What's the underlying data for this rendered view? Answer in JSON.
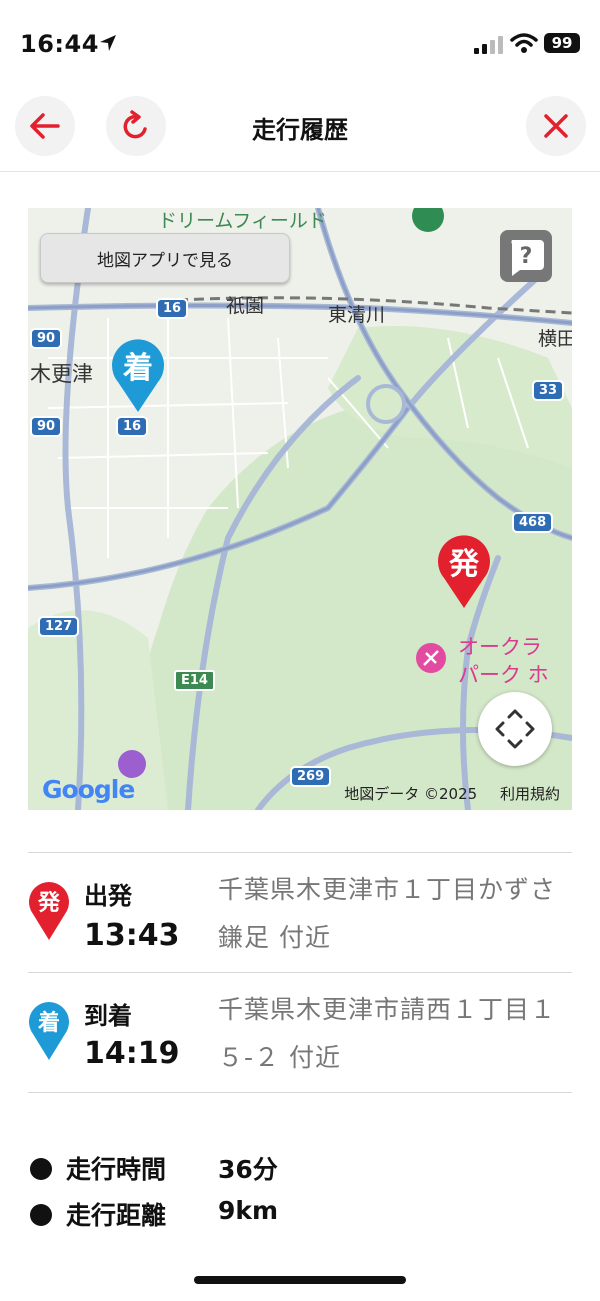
{
  "status_bar": {
    "time": "16:44",
    "battery": "99"
  },
  "header": {
    "title": "走行履歴"
  },
  "map": {
    "open_app_label": "地図アプリで見る",
    "help_label": "?",
    "places": {
      "dreamfield": "ドリームフィールド",
      "gion": "祇園",
      "higashikiyokawa": "東清川",
      "kisarazu": "木更津",
      "yoko": "横田",
      "okura_line1": "オークラ",
      "okura_line2": "パーク ホ"
    },
    "routes": [
      "16",
      "90",
      "90",
      "16",
      "33",
      "468",
      "127",
      "E14",
      "269"
    ],
    "pin_arrival": "着",
    "pin_departure": "発",
    "attribution": "地図データ ©2025",
    "terms": "利用規約",
    "google": "Google"
  },
  "departure": {
    "badge": "発",
    "label": "出発",
    "time": "13:43",
    "address": "千葉県木更津市１丁目かずさ鎌足 付近"
  },
  "arrival": {
    "badge": "着",
    "label": "到着",
    "time": "14:19",
    "address": "千葉県木更津市請西１丁目１５-２ 付近"
  },
  "summary": {
    "duration_label": "走行時間",
    "duration_value": "36分",
    "distance_label": "走行距離",
    "distance_value": "9km"
  },
  "colors": {
    "accent_red": "#e3202e",
    "accent_blue": "#1e9bd7",
    "map_green": "#cfe5c4"
  }
}
